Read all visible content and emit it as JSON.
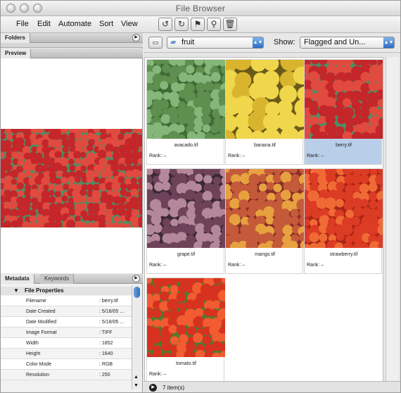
{
  "window": {
    "title": "File Browser"
  },
  "menu": {
    "file": "File",
    "edit": "Edit",
    "automate": "Automate",
    "sort": "Sort",
    "view": "View"
  },
  "left_panel": {
    "tabs": {
      "folders": "Folders",
      "preview": "Preview"
    },
    "metadata_tabs": {
      "metadata": "Metadata",
      "keywords": "Keywords"
    },
    "file_properties": {
      "group_label": "File Properties",
      "rows": [
        {
          "key": "Filename",
          "value": ": berry.tif"
        },
        {
          "key": "Date Created",
          "value": ": 5/18/05 ..."
        },
        {
          "key": "Date Modified",
          "value": ": 5/18/05 ..."
        },
        {
          "key": "Image Format",
          "value": ": TIFF"
        },
        {
          "key": "Width",
          "value": ": 1852"
        },
        {
          "key": "Height",
          "value": ": 1640"
        },
        {
          "key": "Color Mode",
          "value": ": RGB"
        },
        {
          "key": "Resolution",
          "value": ": 250"
        }
      ]
    }
  },
  "right_panel": {
    "folder": "fruit",
    "show_label": "Show:",
    "show_value": "Flagged and Un...",
    "thumbnails": [
      {
        "filename": "avacado.tif",
        "rank": "Rank: –",
        "selected": false,
        "palette": [
          "#5f8f4e",
          "#85b67a",
          "#3f6a36"
        ]
      },
      {
        "filename": "banana.tif",
        "rank": "Rank: –",
        "selected": false,
        "palette": [
          "#f0d64a",
          "#d9b52e",
          "#6a5a1a"
        ]
      },
      {
        "filename": "berry.tif",
        "rank": "Rank: –",
        "selected": true,
        "palette": [
          "#c4262a",
          "#e14a3e",
          "#4e8e63"
        ]
      },
      {
        "filename": "grape.tif",
        "rank": "Rank: –",
        "selected": false,
        "palette": [
          "#6e4359",
          "#b4889a",
          "#3c2836"
        ]
      },
      {
        "filename": "mango.tif",
        "rank": "Rank: –",
        "selected": false,
        "palette": [
          "#c45a3a",
          "#e7a13e",
          "#8a2e2a"
        ]
      },
      {
        "filename": "strawberry.tif",
        "rank": "Rank: –",
        "selected": false,
        "palette": [
          "#dc3b24",
          "#f06a35",
          "#aa2616"
        ]
      },
      {
        "filename": "tomato.tif",
        "rank": "Rank: –",
        "selected": false,
        "palette": [
          "#d7311f",
          "#f35b31",
          "#4c7d2f"
        ]
      }
    ],
    "status": "7 item(s)"
  },
  "colors": {
    "selection": "#b9cfe9",
    "accent": "#2d6cc6"
  }
}
